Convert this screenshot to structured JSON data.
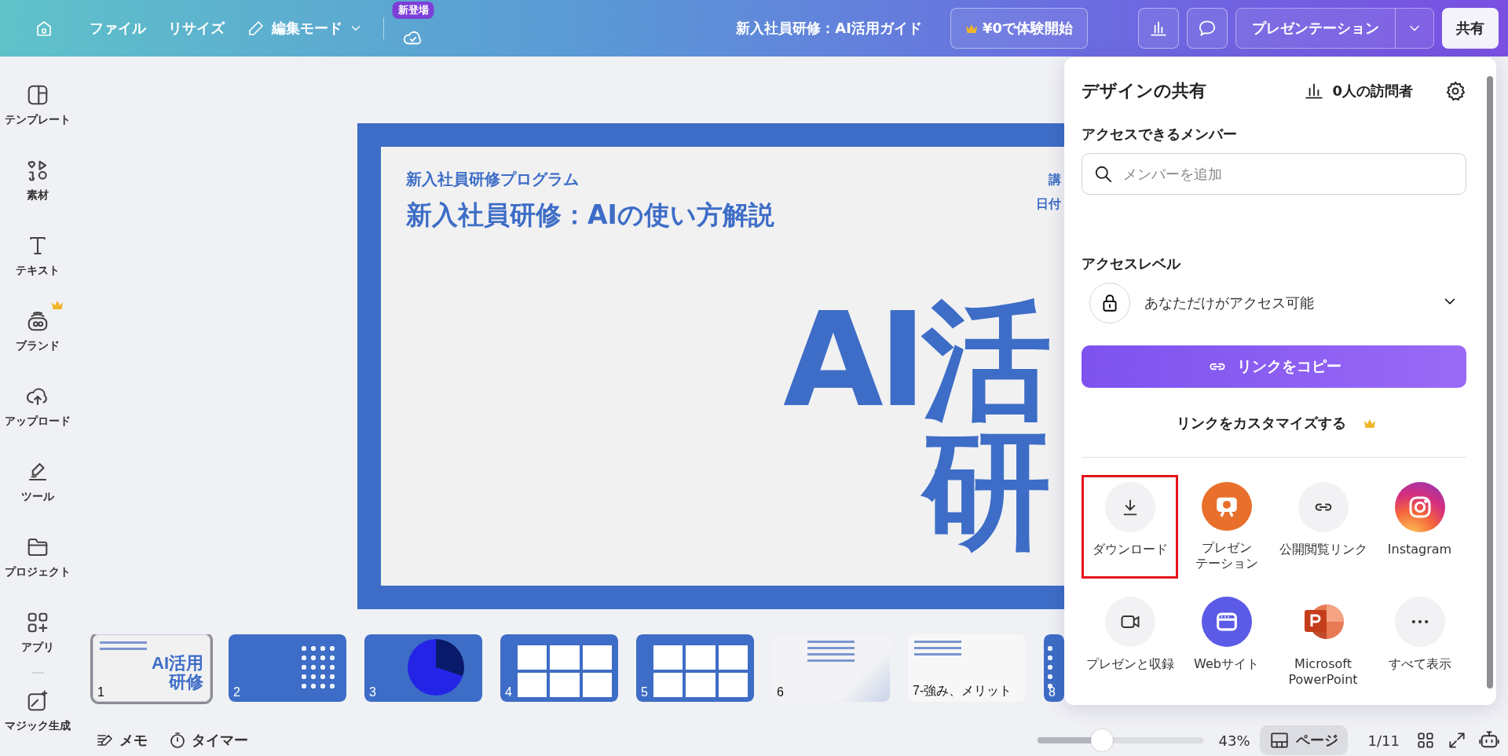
{
  "top_bar": {
    "menu": [
      {
        "label": "ファイル"
      },
      {
        "label": "リサイズ"
      }
    ],
    "edit_mode": "編集モード",
    "new_badge": "新登場",
    "doc_title": "新入社員研修：AI活用ガイド",
    "trial_button": "¥0で体験開始",
    "present_button": "プレゼンテーション",
    "share_button": "共有"
  },
  "sidebar": {
    "items": [
      {
        "label": "テンプレート",
        "kind": "template",
        "premium": false
      },
      {
        "label": "素材",
        "kind": "elements",
        "premium": false
      },
      {
        "label": "テキスト",
        "kind": "text",
        "premium": false
      },
      {
        "label": "ブランド",
        "kind": "brand",
        "premium": true
      },
      {
        "label": "アップロード",
        "kind": "upload",
        "premium": false
      },
      {
        "label": "ツール",
        "kind": "tools",
        "premium": false
      },
      {
        "label": "プロジェクト",
        "kind": "projects",
        "premium": false
      },
      {
        "label": "アプリ",
        "kind": "apps",
        "premium": false
      },
      {
        "label": "マジック生成",
        "kind": "magic",
        "premium": false
      }
    ]
  },
  "slide": {
    "subtitle": "新入社員研修プログラム",
    "title": "新入社員研修：AIの使い方解説",
    "side_lines": [
      "講",
      "日付"
    ],
    "big_lines": [
      "AI活",
      "研"
    ]
  },
  "thumbnails": [
    {
      "label": "1",
      "kind": "title",
      "selected": true,
      "preview_lines": [
        "AI活用",
        "研修"
      ]
    },
    {
      "label": "2",
      "kind": "blue",
      "selected": false
    },
    {
      "label": "3",
      "kind": "chart",
      "selected": false
    },
    {
      "label": "4",
      "kind": "cards",
      "selected": false
    },
    {
      "label": "5",
      "kind": "cards",
      "selected": false
    },
    {
      "label": "6",
      "kind": "light",
      "selected": false
    },
    {
      "label": "7-強み、メリット",
      "kind": "list",
      "selected": false
    },
    {
      "label": "8",
      "kind": "blue",
      "selected": false
    }
  ],
  "bottom_bar": {
    "notes": "メモ",
    "timer": "タイマー",
    "zoom": {
      "level": 0.39
    },
    "zoom_reading": "43%",
    "page_view": "ページ",
    "page_counter": "1/11"
  },
  "share_panel": {
    "title": "デザインの共有",
    "visitors": "0人の訪問者",
    "members_heading": "アクセスできるメンバー",
    "search": {
      "placeholder": "メンバーを追加"
    },
    "access_heading": "アクセスレベル",
    "access_value": "あなただけがアクセス可能",
    "copy_link": "リンクをコピー",
    "customize_link": "リンクをカスタマイズする",
    "customize_premium": true,
    "options": [
      {
        "label": "ダウンロード",
        "kind": "download",
        "highlighted": true
      },
      {
        "label": "プレゼンテーション",
        "kind": "present",
        "highlighted": false
      },
      {
        "label": "公開閲覧リンク",
        "kind": "link",
        "highlighted": false
      },
      {
        "label": "Instagram",
        "kind": "instagram",
        "highlighted": false
      },
      {
        "label": "プレゼンと収録",
        "kind": "record",
        "highlighted": false
      },
      {
        "label": "Webサイト",
        "kind": "website",
        "highlighted": false
      },
      {
        "label": "Microsoft PowerPoint",
        "kind": "powerpoint",
        "highlighted": false
      },
      {
        "label": "すべて表示",
        "kind": "more",
        "highlighted": false
      }
    ]
  }
}
